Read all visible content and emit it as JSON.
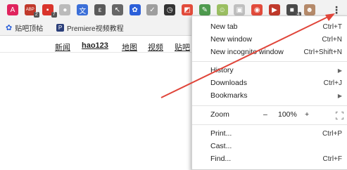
{
  "toolbar": {
    "extensions": [
      {
        "icon": "adblock-icon",
        "color": "#e0245e",
        "glyph": "A",
        "badge": ""
      },
      {
        "icon": "abp-icon",
        "color": "#c0392b",
        "glyph": "ABP",
        "badge": "2"
      },
      {
        "icon": "red-tag-icon",
        "color": "#d9342b",
        "glyph": "▪",
        "badge": "7"
      },
      {
        "icon": "gray-circle-icon",
        "color": "#bbbbbb",
        "glyph": "●",
        "badge": ""
      },
      {
        "icon": "translate-icon",
        "color": "#3b6fd8",
        "glyph": "文",
        "badge": ""
      },
      {
        "icon": "leaf-icon",
        "color": "#5a5a5a",
        "glyph": "ε",
        "badge": ""
      },
      {
        "icon": "pin-icon",
        "color": "#666666",
        "glyph": "↖",
        "badge": ""
      },
      {
        "icon": "baidu-paw-icon",
        "color": "#2b5fd9",
        "glyph": "✿",
        "badge": ""
      },
      {
        "icon": "checkmark-icon",
        "color": "#9e9e9e",
        "glyph": "✓",
        "badge": ""
      },
      {
        "icon": "clock-icon",
        "color": "#333333",
        "glyph": "◷",
        "badge": ""
      },
      {
        "icon": "chrome-store-icon",
        "color": "#e24b3b",
        "glyph": "◩",
        "badge": ""
      },
      {
        "icon": "pen-icon",
        "color": "#4e9a4e",
        "glyph": "✎",
        "badge": ""
      },
      {
        "icon": "face-icon",
        "color": "#9bbf62",
        "glyph": "☺",
        "badge": ""
      },
      {
        "icon": "snapshot-icon",
        "color": "#bfbfbf",
        "glyph": "▣",
        "badge": ""
      },
      {
        "icon": "location-pin-icon",
        "color": "#e24b3b",
        "glyph": "◉",
        "badge": ""
      },
      {
        "icon": "video-icon",
        "color": "#c0392b",
        "glyph": "▶",
        "badge": ""
      },
      {
        "icon": "counter-icon",
        "color": "#4a4a4a",
        "glyph": "■",
        "badge": "4"
      },
      {
        "icon": "profile-avatar-icon",
        "color": "#b58a6a",
        "glyph": "☻",
        "badge": ""
      }
    ],
    "menu_icon_label": "⋮"
  },
  "bookmarks": [
    {
      "icon": "baidu-paw-icon",
      "label": "贴吧顶帖"
    },
    {
      "icon": "premiere-icon",
      "label": "Premiere视频教程"
    }
  ],
  "nav_links": [
    "新闻",
    "hao123",
    "地图",
    "视频",
    "贴吧"
  ],
  "menu": {
    "group1": [
      {
        "label": "New tab",
        "shortcut": "Ctrl+T"
      },
      {
        "label": "New window",
        "shortcut": "Ctrl+N"
      },
      {
        "label": "New incognito window",
        "shortcut": "Ctrl+Shift+N"
      }
    ],
    "group2": [
      {
        "label": "History",
        "shortcut": "▶"
      },
      {
        "label": "Downloads",
        "shortcut": "Ctrl+J"
      },
      {
        "label": "Bookmarks",
        "shortcut": "▶"
      }
    ],
    "zoom": {
      "label": "Zoom",
      "minus": "–",
      "value": "100%",
      "plus": "+"
    },
    "group3": [
      {
        "label": "Print...",
        "shortcut": "Ctrl+P"
      },
      {
        "label": "Cast...",
        "shortcut": ""
      },
      {
        "label": "Find...",
        "shortcut": "Ctrl+F"
      }
    ]
  },
  "annotation_color": "#e0453a"
}
